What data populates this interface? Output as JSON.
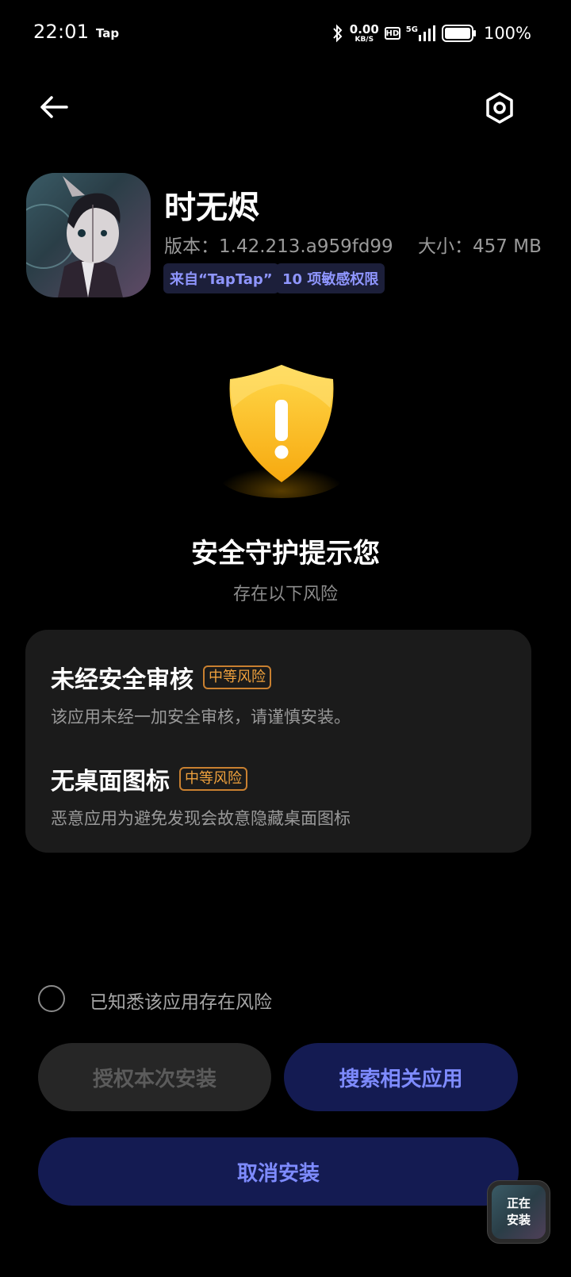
{
  "status_bar": {
    "time": "22:01",
    "notification": "Tap",
    "net_speed_value": "0.00",
    "net_speed_unit": "KB/S",
    "hd": "HD",
    "signal": "5G",
    "battery": "100%"
  },
  "icons": {
    "back": "arrow-left-icon",
    "settings": "gear-hexagon-icon",
    "shield": "warning-shield-icon"
  },
  "app": {
    "name": "时无烬",
    "version_label": "版本：",
    "version": "1.42.213.a959fd99",
    "size_label": "大小：",
    "size": "457 MB",
    "source_tag": "来自“TapTap”",
    "perm_tag": "10 项敏感权限"
  },
  "warning": {
    "title": "安全守护提示您",
    "subtitle": "存在以下风险"
  },
  "risks": [
    {
      "title": "未经安全审核",
      "level": "中等风险",
      "desc": "该应用未经一加安全审核，请谨慎安装。"
    },
    {
      "title": "无桌面图标",
      "level": "中等风险",
      "desc": "恶意应用为避免发现会故意隐藏桌面图标"
    }
  ],
  "ack": {
    "label": "已知悉该应用存在风险",
    "checked": false
  },
  "buttons": {
    "authorize": "授权本次安装",
    "search": "搜索相关应用",
    "cancel": "取消安装"
  },
  "installing": {
    "line1": "正在",
    "line2": "安装"
  },
  "colors": {
    "accent": "#7e8bff",
    "accent_bg": "#141b52",
    "risk": "#f1a23d",
    "shield": "#ffc623"
  }
}
